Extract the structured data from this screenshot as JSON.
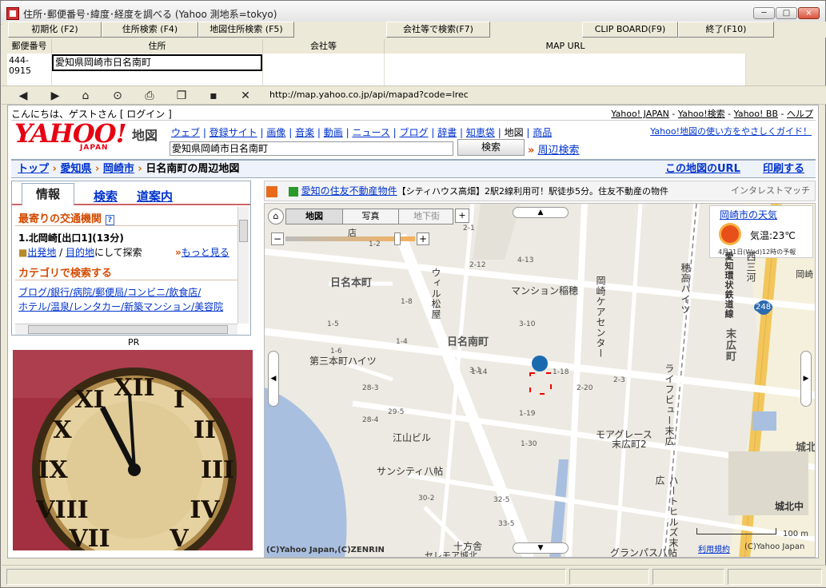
{
  "window": {
    "title": "住所･郵便番号･緯度･経度を調べる (Yahoo 測地系=tokyo)",
    "minimize": "─",
    "maximize": "□",
    "close": "×"
  },
  "toolbar": {
    "init": "初期化 (F2)",
    "addr_search": "住所検索 (F4)",
    "map_addr_search": "地図住所検索 (F5)",
    "company_search": "会社等で検索(F7)",
    "clipboard": "CLIP BOARD(F9)",
    "exit": "終了(F10)"
  },
  "columns": {
    "zip": "郵便番号",
    "address": "住所",
    "company": "会社等",
    "map_url": "MAP URL"
  },
  "record": {
    "zip": "444-0915",
    "address": "愛知県岡崎市日名南町"
  },
  "nav": {
    "address_url": "http://map.yahoo.co.jp/api/mapad?code=lrec"
  },
  "yahoo": {
    "greeting": "こんにちは、ゲストさん [ ログイン ]",
    "toplinks": [
      "Yahoo! JAPAN",
      "Yahoo!検索",
      "Yahoo! BB",
      "ヘルプ"
    ],
    "logo": "YAHOO!",
    "logo_sub": "JAPAN",
    "section": "地図",
    "services": [
      "ウェブ",
      "登録サイト",
      "画像",
      "音楽",
      "動画",
      "ニュース",
      "ブログ",
      "辞書",
      "知恵袋",
      "地図",
      "商品"
    ],
    "help_link": "Yahoo!地図の使い方をやさしくガイド！",
    "search_value": "愛知県岡崎市日名南町",
    "search_button": "検索",
    "nearby": "周辺検索",
    "breadcrumb": {
      "top": "トップ",
      "pref": "愛知県",
      "city": "岡崎市",
      "current": "日名南町の周辺地図",
      "map_url": "この地図のURL",
      "print": "印刷する"
    }
  },
  "panel": {
    "tabs": [
      "情報",
      "検索",
      "道案内"
    ],
    "transit_title": "最寄りの交通機関",
    "station": "1.北岡崎[出口1](13分)",
    "from": "出発地",
    "to": "目的地",
    "explore": "にして探索",
    "more": "もっと見る",
    "category_title": "カテゴリで検索する",
    "cats1": "ブログ/銀行/病院/郵便局/コンビニ/飲食店/",
    "cats2": "ホテル/温泉/レンタカー/新築マンション/美容院",
    "pr": "PR"
  },
  "ad": {
    "link": "愛知の住友不動産物件",
    "text": "【シティハウス高畑】2駅2線利用可！駅徒歩5分。住友不動産の物件",
    "sponsor": "インタレストマッチ"
  },
  "map": {
    "modes": [
      "地図",
      "写真",
      "地下街"
    ],
    "weather_link": "岡崎市の天気",
    "temp": "気温:23℃",
    "forecast": "4月21日(Wed)12時の予報",
    "labels": {
      "hinahon": "日名本町",
      "hinaminami": "日名南町",
      "daisan": "第三本町ハイツ",
      "mansion": "マンション稲穂",
      "eyama": "江山ビル",
      "sunshine": "サンシティ八帖",
      "moa": "モアグレース",
      "moa2": "末広町2",
      "suehiro": "末広町",
      "johoku": "城北中",
      "grand": "グランパス八帖",
      "jippo": "十方舎",
      "shiro": "城北",
      "route": "248",
      "scale": "100 m",
      "copy": "(C)Yahoo Japan,(C)ZENRIN",
      "terms": "利用規約",
      "copy2": "(C)Yahoo Japan",
      "ten": "店",
      "serekusa": "セレモア城北",
      "okazaki": "岡崎"
    },
    "vlabels": {
      "uirumatsuya": "ウィル松屋",
      "care": "岡崎ケアセンター",
      "hotaka": "穂高ハイツ",
      "line": "愛知環状鉄道線",
      "suehiro2": "末広町",
      "lifeview": "ライフビュー末広",
      "hartehills": "ハートヒルズ末広",
      "nishiko": "西三河"
    },
    "blocks": [
      "1-5",
      "1-6",
      "1-4",
      "1-8",
      "4-13",
      "2-12",
      "3-10",
      "3-1",
      "1-14",
      "1-18",
      "1-19",
      "1-30",
      "2-20",
      "2-3",
      "28-3",
      "28-4",
      "29-5",
      "30-2",
      "32-5",
      "33-5",
      "1-2",
      "2-1"
    ]
  },
  "status": {
    "panes": [
      "",
      "",
      "",
      ""
    ]
  }
}
